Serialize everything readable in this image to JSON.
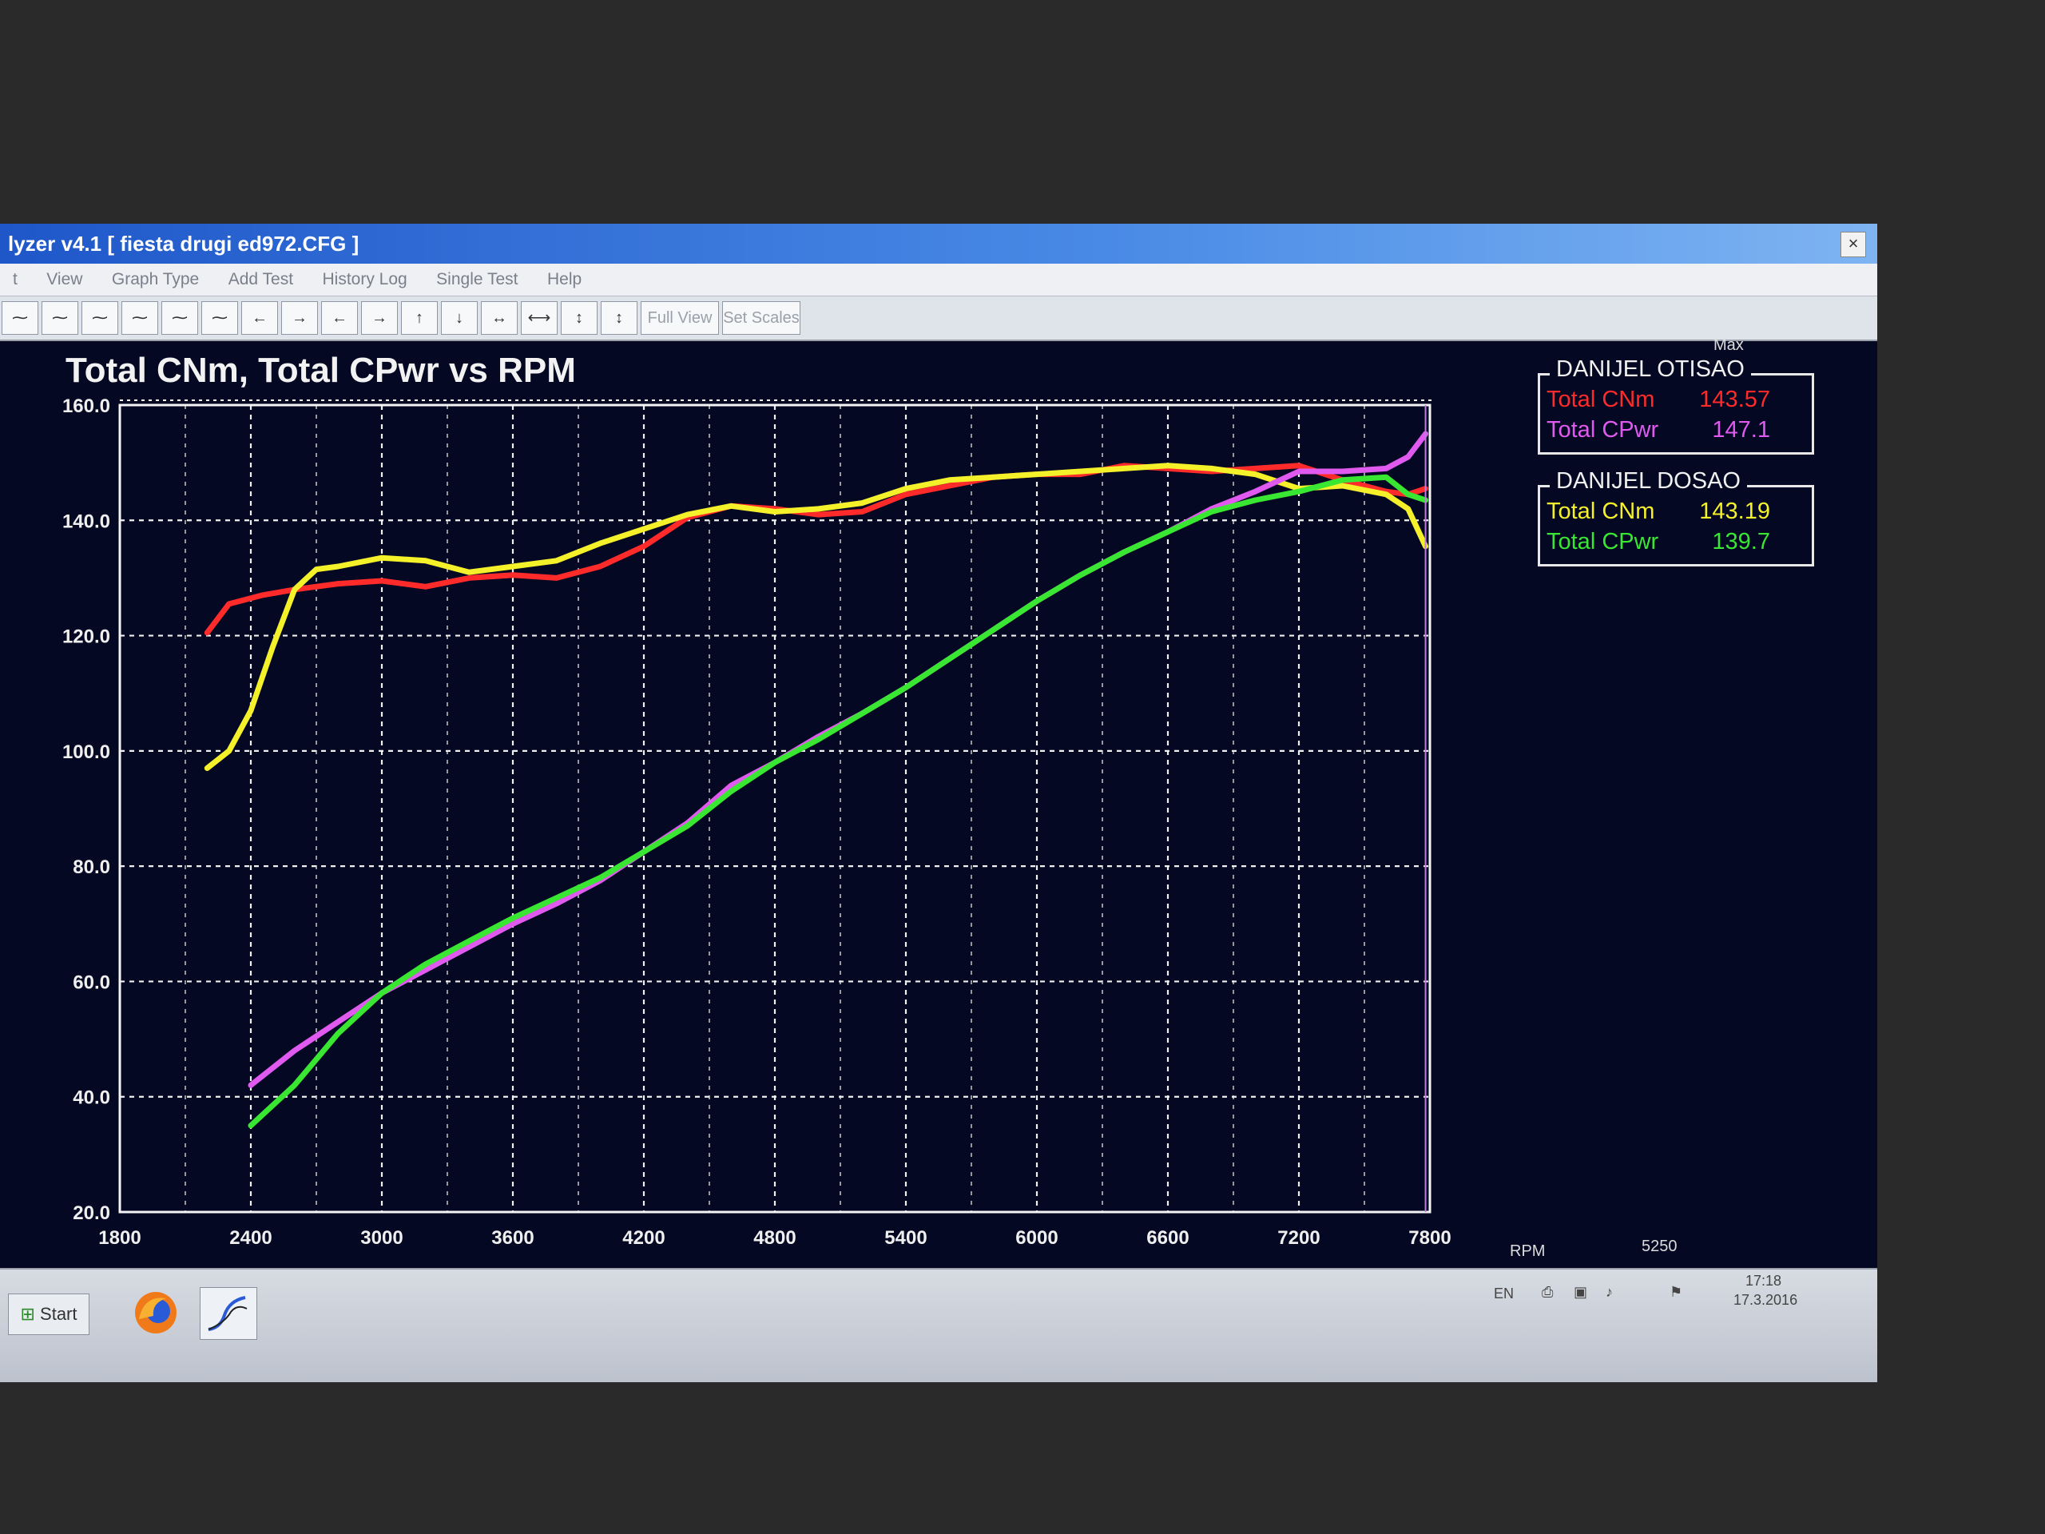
{
  "window": {
    "title": "lyzer v4.1  [ fiesta drugi ed972.CFG ]",
    "close_glyph": "×"
  },
  "menu": [
    {
      "label": "t"
    },
    {
      "label": "View"
    },
    {
      "label": "Graph Type"
    },
    {
      "label": "Add Test"
    },
    {
      "label": "History Log"
    },
    {
      "label": "Single Test"
    },
    {
      "label": "Help"
    }
  ],
  "toolbar": {
    "icon_buttons": [
      {
        "icon": "graph-1-icon",
        "glyph": "⁓"
      },
      {
        "icon": "graph-2-icon",
        "glyph": "⁓"
      },
      {
        "icon": "graph-3-icon",
        "glyph": "⁓"
      },
      {
        "icon": "graph-4-icon",
        "glyph": "⁓"
      },
      {
        "icon": "graph-5-icon",
        "glyph": "⁓"
      },
      {
        "icon": "graph-6-icon",
        "glyph": "⁓"
      },
      {
        "icon": "arrow-left-icon",
        "glyph": "←"
      },
      {
        "icon": "arrow-right-icon",
        "glyph": "→"
      },
      {
        "icon": "step-left-icon",
        "glyph": "←"
      },
      {
        "icon": "step-right-icon",
        "glyph": "→"
      },
      {
        "icon": "arrow-up-icon",
        "glyph": "↑"
      },
      {
        "icon": "arrow-down-icon",
        "glyph": "↓"
      },
      {
        "icon": "expand-horizontal-icon",
        "glyph": "↔"
      },
      {
        "icon": "compress-horizontal-icon",
        "glyph": "⟷"
      },
      {
        "icon": "compress-vertical-icon",
        "glyph": "↕"
      },
      {
        "icon": "expand-vertical-icon",
        "glyph": "↕"
      }
    ],
    "full_view_label": "Full View",
    "set_scales_label": "Set Scales"
  },
  "legend": {
    "max_label": "Max",
    "groups": [
      {
        "name": "DANIJEL OTISAO",
        "rows": [
          {
            "label": "Total CNm",
            "value": "143.57",
            "color": "#ff2a2a"
          },
          {
            "label": "Total CPwr",
            "value": "147.1",
            "color": "#e05af0"
          }
        ]
      },
      {
        "name": "DANIJEL DOSAO",
        "rows": [
          {
            "label": "Total CNm",
            "value": "143.19",
            "color": "#f4f02a"
          },
          {
            "label": "Total CPwr",
            "value": "139.7",
            "color": "#39e632"
          }
        ]
      }
    ]
  },
  "status": {
    "cursor_label": "RPM",
    "cursor_value": "5250"
  },
  "taskbar": {
    "start_label": "Start",
    "apps": [
      {
        "icon": "firefox-icon"
      },
      {
        "icon": "dyno-analyzer-icon"
      }
    ],
    "tray": {
      "lang": "EN",
      "time": "17:18",
      "date": "17.3.2016"
    }
  },
  "chart_data": {
    "type": "line",
    "title": "Total CNm, Total CPwr vs RPM",
    "xlabel": "",
    "ylabel": "",
    "xlim": [
      1800,
      7800
    ],
    "ylim": [
      20,
      160
    ],
    "xticks": [
      1800,
      2400,
      3000,
      3600,
      4200,
      4800,
      5400,
      6000,
      6600,
      7200,
      7800
    ],
    "yticks": [
      "20.0",
      "40.0",
      "60.0",
      "80.0",
      "100.0",
      "120.0",
      "140.0",
      "160.0"
    ],
    "grid": true,
    "cursor_rpm": 7780,
    "series": [
      {
        "name": "Total CNm",
        "group": "DANIJEL OTISAO",
        "color": "#ff2a2a",
        "x": [
          2200,
          2300,
          2450,
          2600,
          2800,
          3000,
          3200,
          3400,
          3600,
          3800,
          4000,
          4200,
          4400,
          4600,
          4800,
          5000,
          5200,
          5400,
          5600,
          5800,
          6000,
          6200,
          6400,
          6600,
          6800,
          7000,
          7200,
          7400,
          7600,
          7700,
          7780
        ],
        "y": [
          120.5,
          125.5,
          127,
          128,
          129,
          129.5,
          128.5,
          130,
          130.5,
          130,
          132,
          135.5,
          140.5,
          142.5,
          142,
          141,
          141.5,
          144.5,
          146,
          147.5,
          148,
          148,
          149.5,
          149,
          148.5,
          149,
          149.5,
          147,
          145,
          144.5,
          145.5
        ]
      },
      {
        "name": "Total CNm",
        "group": "DANIJEL DOSAO",
        "color": "#f4f02a",
        "x": [
          2200,
          2300,
          2400,
          2500,
          2600,
          2700,
          2800,
          3000,
          3200,
          3400,
          3600,
          3800,
          4000,
          4200,
          4400,
          4600,
          4800,
          5000,
          5200,
          5400,
          5600,
          5800,
          6000,
          6200,
          6400,
          6600,
          6800,
          7000,
          7200,
          7400,
          7600,
          7700,
          7780
        ],
        "y": [
          97,
          100,
          107,
          118,
          128,
          131.5,
          132,
          133.5,
          133,
          131,
          132,
          133,
          136,
          138.5,
          141,
          142.5,
          141.5,
          142,
          143,
          145.5,
          147,
          147.5,
          148,
          148.5,
          149,
          149.5,
          149,
          148,
          145.5,
          146,
          144.5,
          142,
          135.5
        ]
      },
      {
        "name": "Total CPwr",
        "group": "DANIJEL OTISAO",
        "color": "#e05af0",
        "x": [
          2400,
          2600,
          2800,
          3000,
          3200,
          3400,
          3600,
          3800,
          4000,
          4200,
          4400,
          4600,
          4800,
          5000,
          5200,
          5400,
          5600,
          5800,
          6000,
          6200,
          6400,
          6600,
          6800,
          7000,
          7200,
          7400,
          7600,
          7700,
          7780
        ],
        "y": [
          42,
          48,
          53,
          58,
          62,
          66,
          70,
          73.5,
          77.5,
          82.5,
          87.5,
          94,
          98,
          102.5,
          106.5,
          111,
          116,
          121,
          126,
          130.5,
          134.5,
          138,
          142,
          145,
          148.5,
          148.5,
          149,
          151,
          155
        ]
      },
      {
        "name": "Total CPwr",
        "group": "DANIJEL DOSAO",
        "color": "#39e632",
        "x": [
          2400,
          2600,
          2800,
          3000,
          3200,
          3400,
          3600,
          3800,
          4000,
          4200,
          4400,
          4600,
          4800,
          5000,
          5200,
          5400,
          5600,
          5800,
          6000,
          6200,
          6400,
          6600,
          6800,
          7000,
          7200,
          7400,
          7600,
          7700,
          7780
        ],
        "y": [
          35,
          42,
          51,
          58,
          63,
          67,
          71,
          74.5,
          78,
          82.5,
          87,
          93,
          98,
          102,
          106.5,
          111,
          116,
          121,
          126,
          130.5,
          134.5,
          138,
          141.5,
          143.5,
          145,
          147,
          147.5,
          144.5,
          143.5
        ]
      }
    ]
  }
}
